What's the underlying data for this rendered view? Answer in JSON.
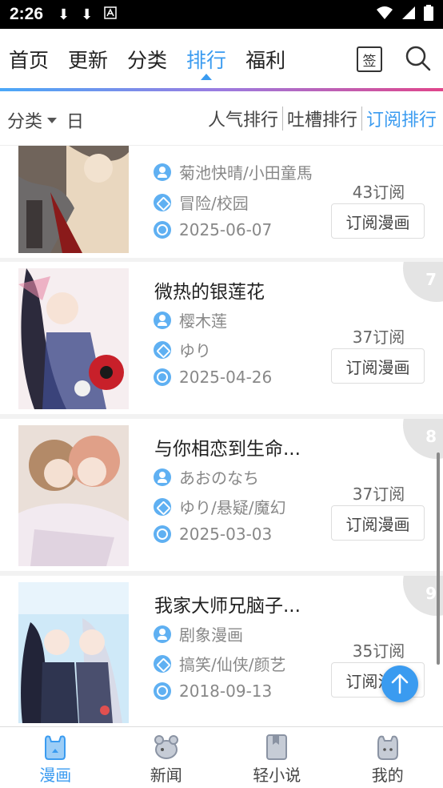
{
  "status": {
    "time": "2:26"
  },
  "nav": {
    "tabs": [
      {
        "label": "首页"
      },
      {
        "label": "更新"
      },
      {
        "label": "分类"
      },
      {
        "label": "排行",
        "active": true
      },
      {
        "label": "福利"
      }
    ],
    "sign_label": "签"
  },
  "filter": {
    "category_label": "分类",
    "period_label": "日",
    "rank_tabs": [
      "人气排行",
      "吐槽排行",
      "订阅排行"
    ],
    "selected_rank": "订阅排行"
  },
  "items": [
    {
      "title": "",
      "author": "菊池快晴/小田童馬",
      "tags": "冒险/校园",
      "date": "2025-06-07",
      "subs": "43订阅",
      "button": "订阅漫画",
      "rank": ""
    },
    {
      "title": "微热的银莲花",
      "author": "樱木莲",
      "tags": "ゆり",
      "date": "2025-04-26",
      "subs": "37订阅",
      "button": "订阅漫画",
      "rank": "7"
    },
    {
      "title": "与你相恋到生命...",
      "author": "あおのなち",
      "tags": "ゆり/悬疑/魔幻",
      "date": "2025-03-03",
      "subs": "37订阅",
      "button": "订阅漫画",
      "rank": "8"
    },
    {
      "title": "我家大师兄脑子...",
      "author": "剧象漫画",
      "tags": "搞笑/仙侠/颜艺",
      "date": "2018-09-13",
      "subs": "35订阅",
      "button": "订阅漫画",
      "rank": "9"
    }
  ],
  "bottom_nav": [
    {
      "label": "漫画",
      "active": true
    },
    {
      "label": "新闻"
    },
    {
      "label": "轻小说"
    },
    {
      "label": "我的"
    }
  ],
  "colors": {
    "accent": "#3a9bf0",
    "badge": "#e4e4e4"
  }
}
